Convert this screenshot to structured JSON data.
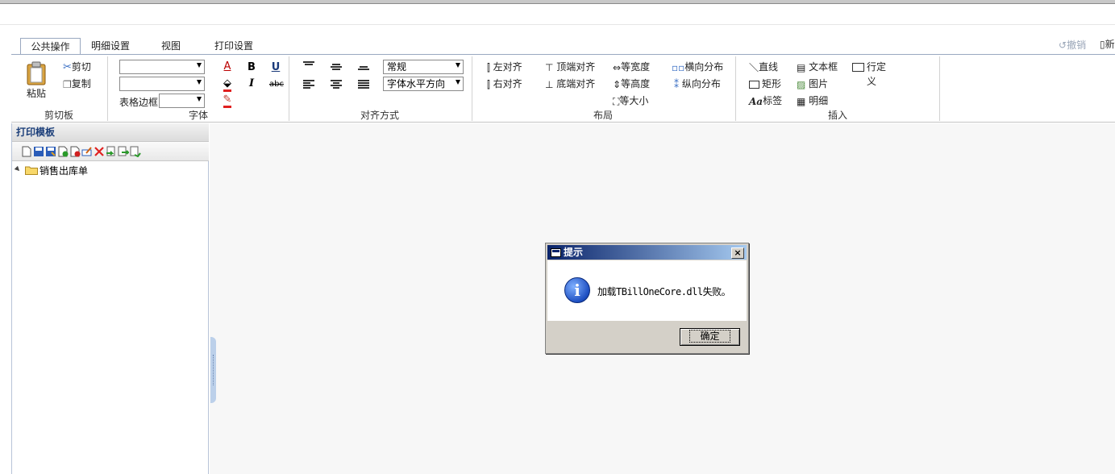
{
  "tabs": [
    "公共操作",
    "明细设置",
    "视图",
    "打印设置"
  ],
  "top_right": {
    "undo": "撤销",
    "new": "新"
  },
  "ribbon": {
    "clipboard": {
      "paste": "粘贴",
      "cut": "剪切",
      "copy": "复制",
      "group": "剪切板"
    },
    "font": {
      "font_name": "",
      "font_size": "",
      "table_border_label": "表格边框",
      "table_border_value": "",
      "bold": "B",
      "italic": "I",
      "underline": "U",
      "strike": "abc",
      "font_color": "A",
      "group": "字体"
    },
    "align": {
      "style_value": "常规",
      "horizontal_value": "字体水平方向",
      "group": "对齐方式"
    },
    "layout": {
      "align_left": "左对齐",
      "align_right": "右对齐",
      "align_top": "顶端对齐",
      "align_bottom": "底端对齐",
      "same_width": "等宽度",
      "same_height": "等高度",
      "same_size": "等大小",
      "h_distribute": "横向分布",
      "v_distribute": "纵向分布",
      "group": "布局"
    },
    "insert": {
      "line": "直线",
      "rect": "矩形",
      "label": "标签",
      "textbox": "文本框",
      "image": "图片",
      "detail": "明细",
      "custom_row": "行定",
      "custom_row2": "义",
      "group": "插入"
    }
  },
  "left_panel": {
    "title": "打印模板",
    "tree": [
      {
        "label": "销售出库单"
      }
    ]
  },
  "dialog": {
    "title": "提示",
    "message": "加载TBillOneCore.dll失败。",
    "ok": "确定",
    "close": "×"
  }
}
